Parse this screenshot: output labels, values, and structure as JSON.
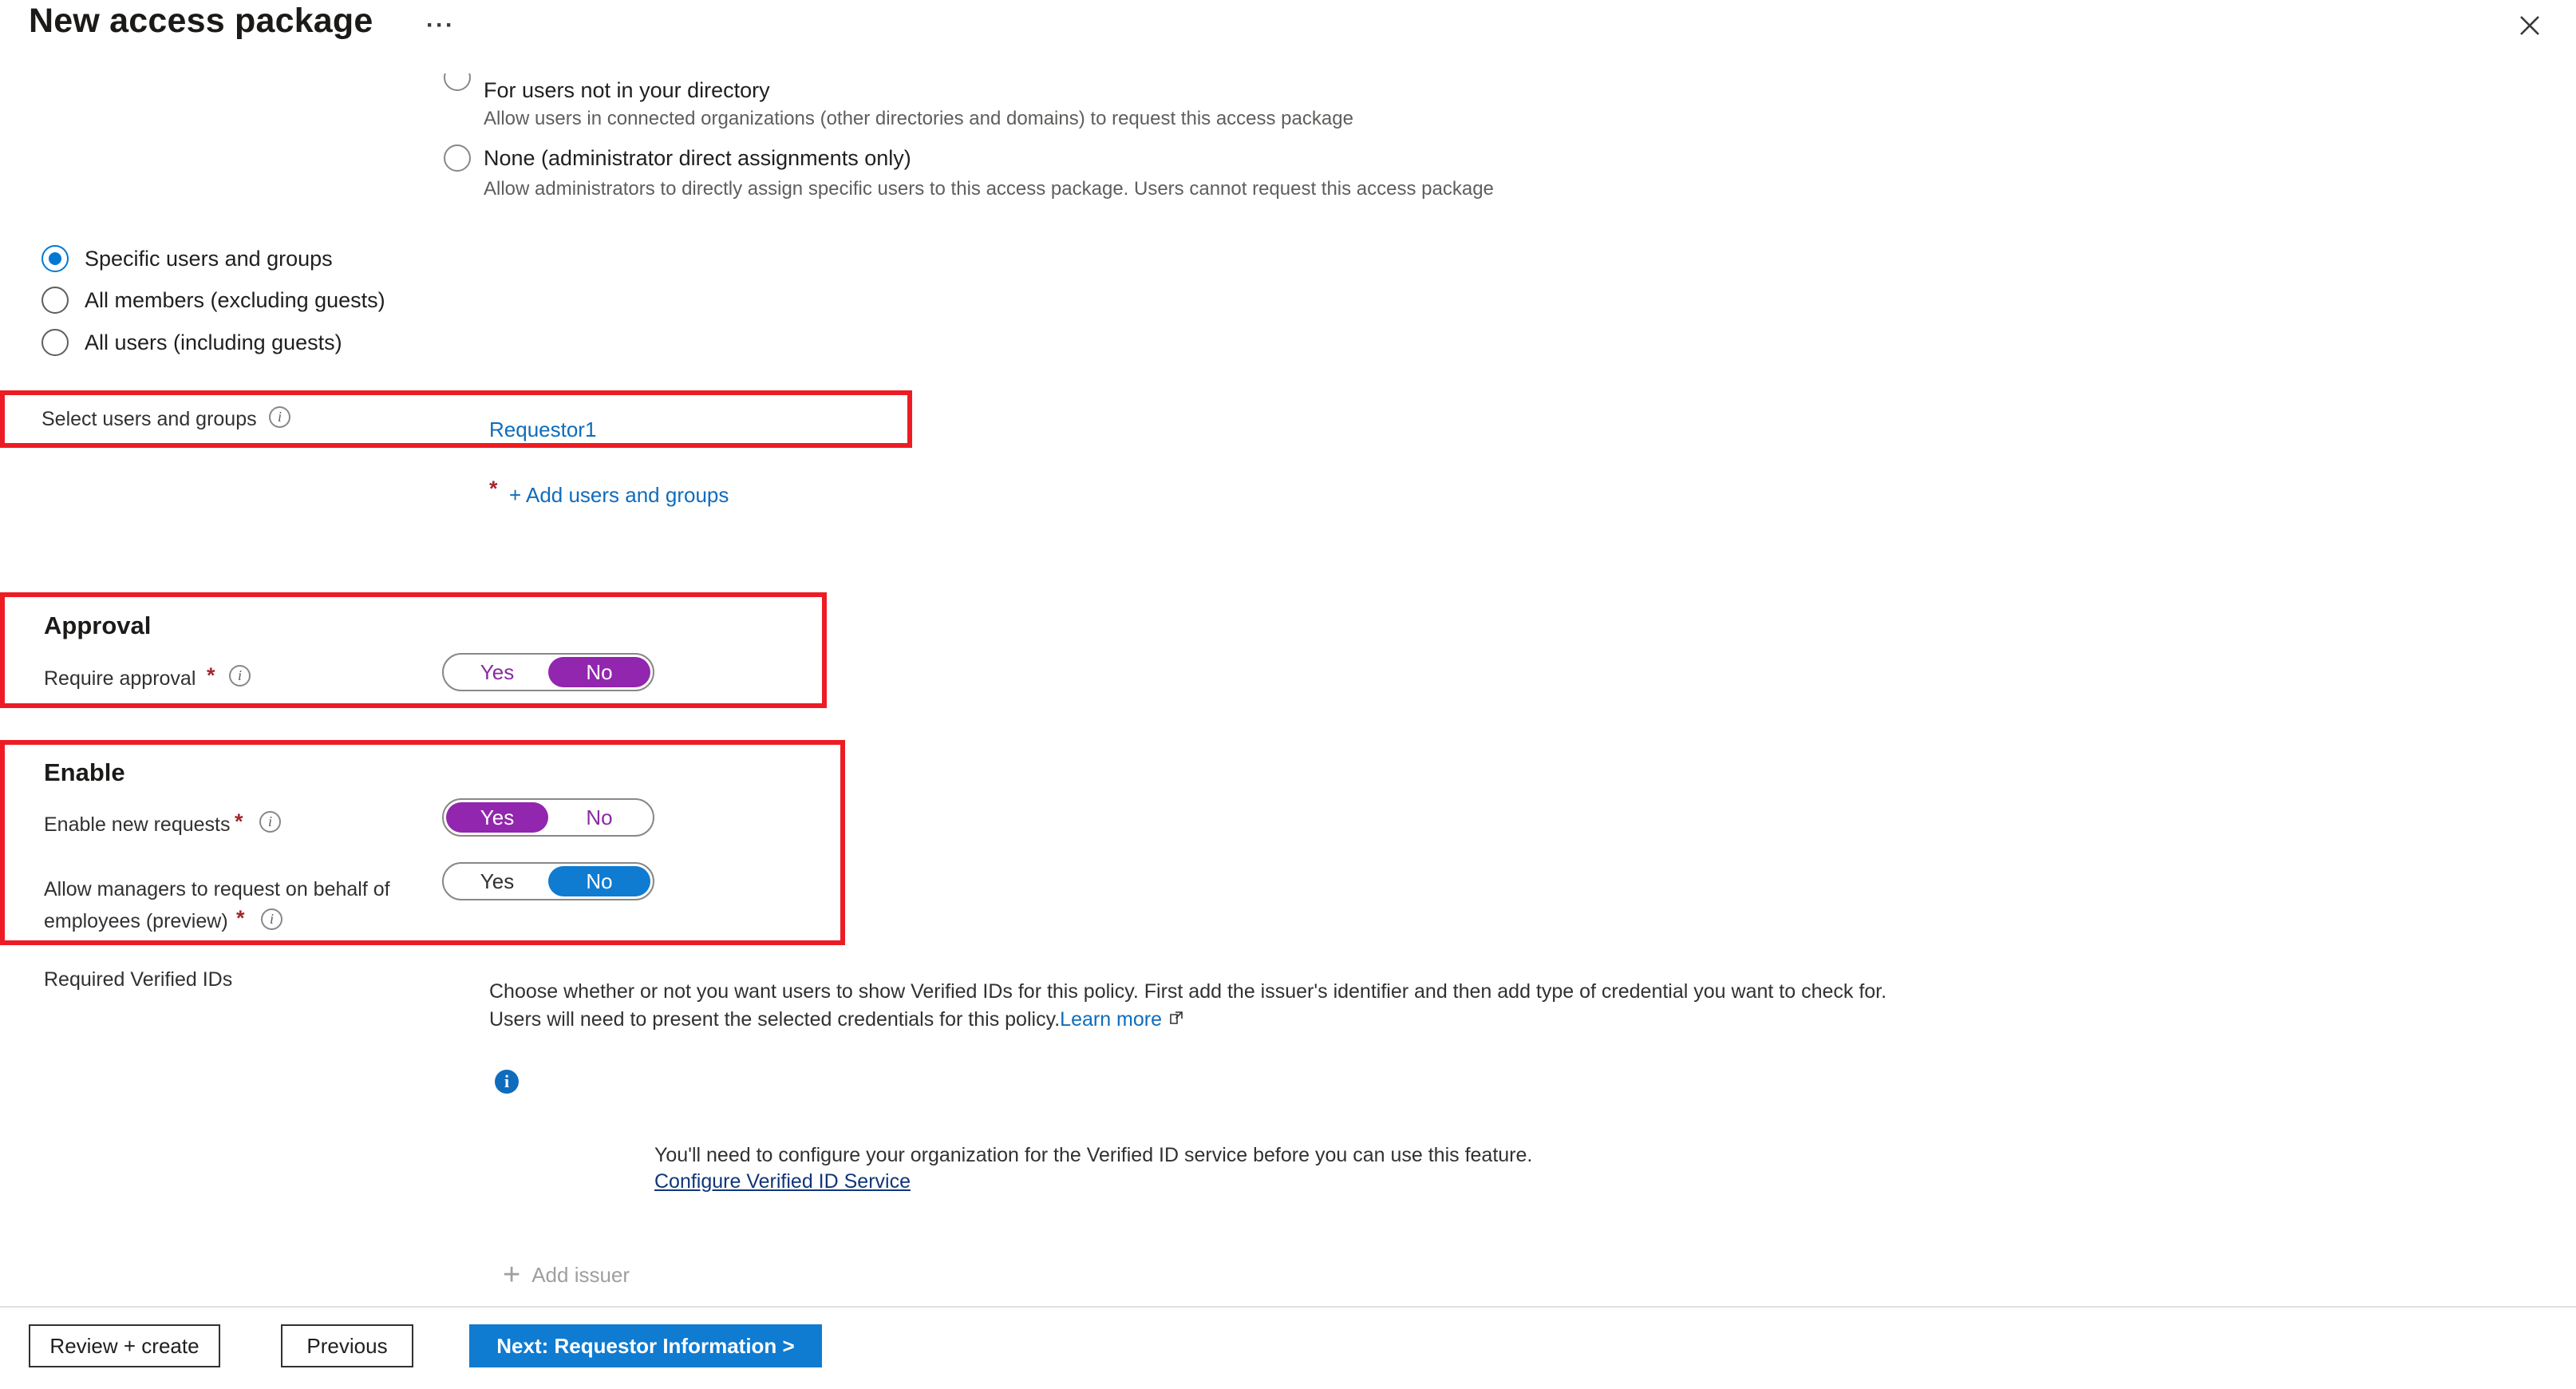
{
  "header": {
    "title": "New access package",
    "ellipsis": "···",
    "close_icon": "close-icon"
  },
  "request_for": {
    "options": [
      {
        "label": "For users not in your directory",
        "description": "Allow users in connected organizations (other directories and domains) to request this access package",
        "selected": false
      },
      {
        "label": "None (administrator direct assignments only)",
        "description": "Allow administrators to directly assign specific users to this access package. Users cannot request this access package",
        "selected": false
      }
    ]
  },
  "scope": {
    "options": [
      {
        "label": "Specific users and groups",
        "selected": true
      },
      {
        "label": "All members (excluding guests)",
        "selected": false
      },
      {
        "label": "All users (including guests)",
        "selected": false
      }
    ]
  },
  "select_users": {
    "label": "Select users and groups",
    "info_icon": "info-icon",
    "value": "Requestor1",
    "required_marker": "*",
    "add_link": "+ Add users and groups"
  },
  "approval": {
    "section_title": "Approval",
    "require_approval": {
      "label": "Require approval",
      "required_marker": "*",
      "info_icon": "info-icon",
      "options": [
        "Yes",
        "No"
      ],
      "selected": "No",
      "accent": "#9226ae"
    }
  },
  "enable": {
    "section_title": "Enable",
    "enable_new_requests": {
      "label": "Enable new requests",
      "required_marker": "*",
      "info_icon": "info-icon",
      "options": [
        "Yes",
        "No"
      ],
      "selected": "Yes",
      "accent": "#9226ae"
    },
    "allow_managers": {
      "label_line1": "Allow managers to request on behalf of",
      "label_line2": "employees (preview)",
      "required_marker": "*",
      "info_icon": "info-icon",
      "options": [
        "Yes",
        "No"
      ],
      "selected": "No",
      "accent": "#0f7bd1"
    }
  },
  "verified_ids": {
    "label": "Required Verified IDs",
    "description_line1": "Choose whether or not you want users to show Verified IDs for this policy. First add the issuer's identifier and then add type of credential you want to check for.",
    "description_line2_prefix": "Users will need to present the selected credentials for this policy. ",
    "learn_more": "Learn more",
    "external_link_icon": "external-link-icon",
    "info_icon": "info-circle-filled-icon",
    "notice": "You'll need to configure your organization for the Verified ID service before you can use this feature.",
    "configure_link": "Configure Verified ID Service",
    "add_issuer": "Add issuer",
    "add_issuer_icon": "plus-icon"
  },
  "footer": {
    "review_create": "Review + create",
    "previous": "Previous",
    "next": "Next: Requestor Information >"
  },
  "colors": {
    "annotation_red": "#ed1c24",
    "link_blue": "#0f6cbd",
    "toggle_purple": "#9226ae",
    "toggle_blue": "#0f7bd1",
    "primary_button": "#0f7bd1"
  }
}
